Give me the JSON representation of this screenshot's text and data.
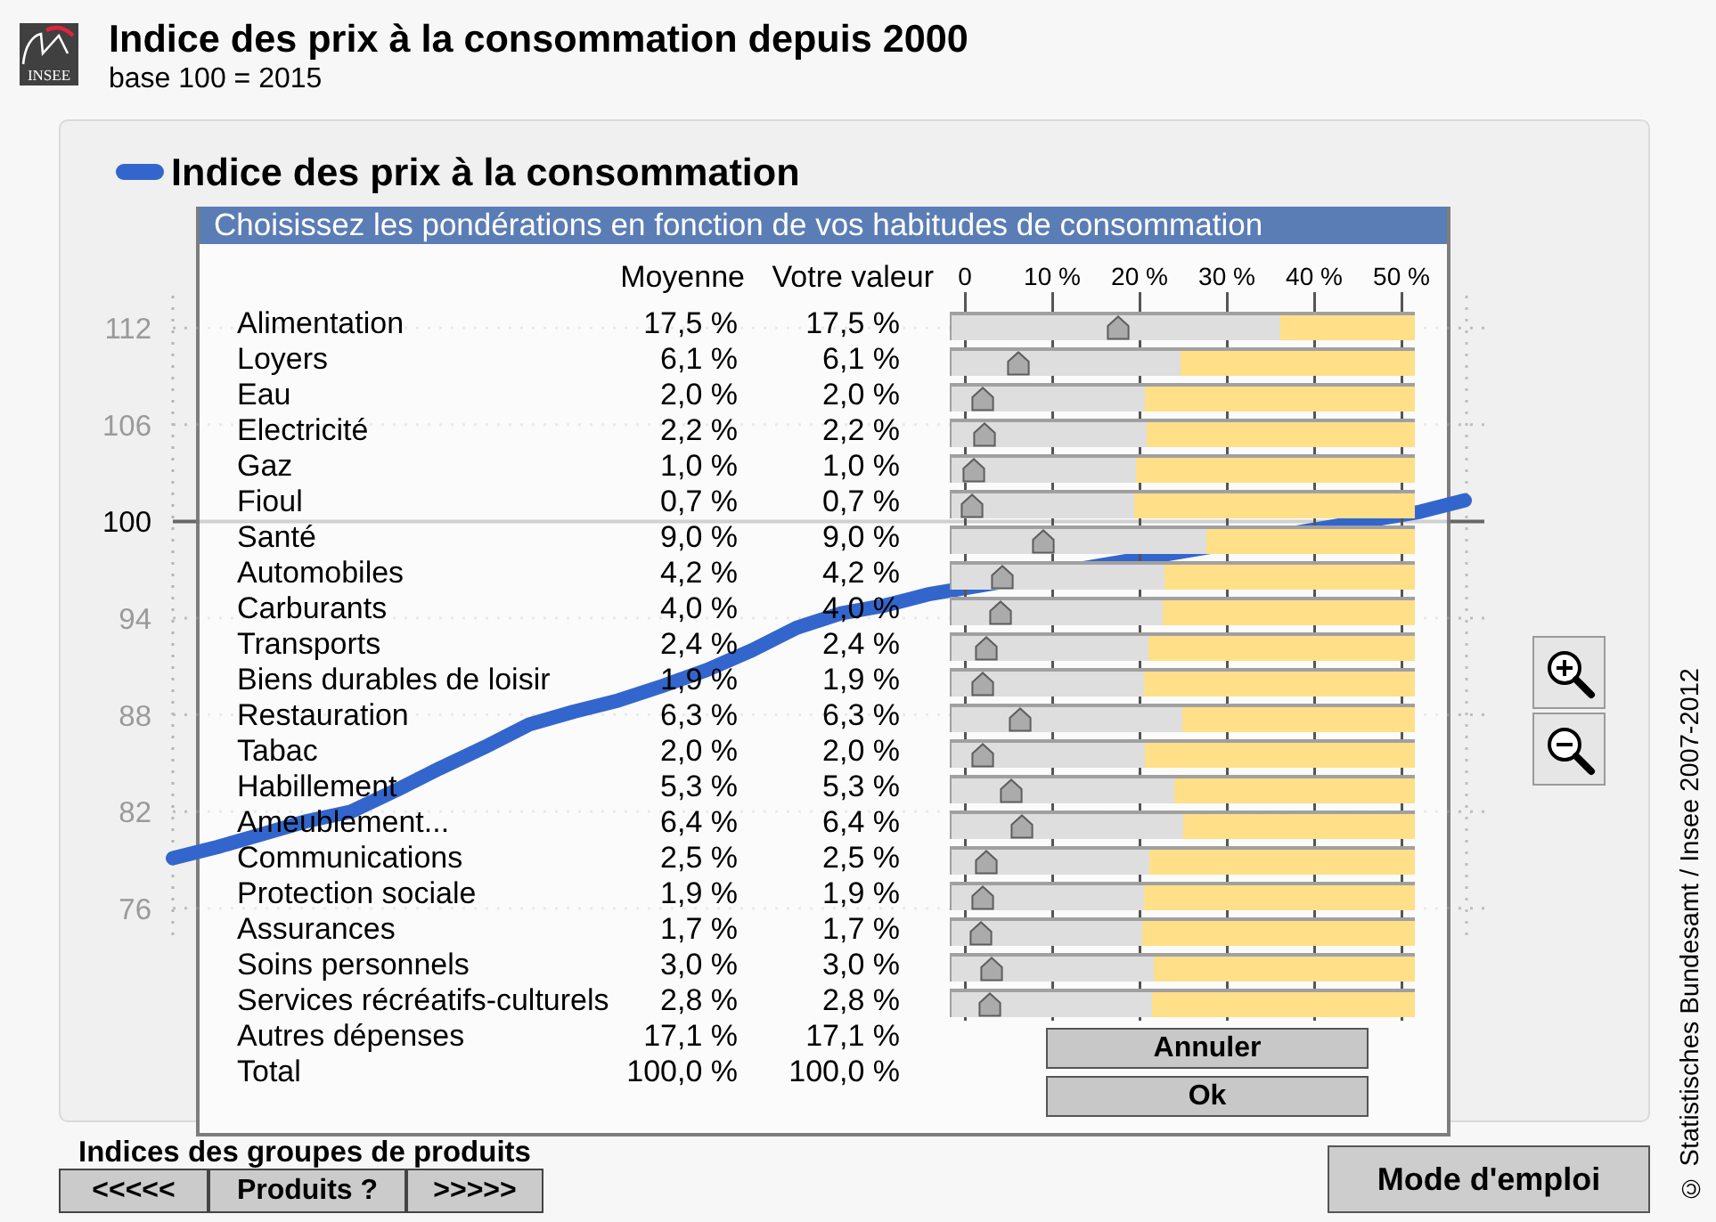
{
  "header": {
    "logo_text": "INSEE",
    "title": "Indice des prix à la consommation depuis 2000",
    "subtitle": "base 100 = 2015"
  },
  "chart": {
    "chart_data": {
      "type": "line",
      "ylim": [
        74,
        114
      ],
      "yticks": [
        76,
        82,
        88,
        94,
        100,
        106,
        112
      ],
      "grid": true,
      "ref_lines": [
        {
          "axis": "y",
          "value": 100
        }
      ],
      "series": [
        {
          "name": "Indice des prix à la consommation",
          "color": "#3366cc",
          "values": [
            79.1,
            79.8,
            80.6,
            81.4,
            82.0,
            83.3,
            84.7,
            86.0,
            87.4,
            88.2,
            88.9,
            89.8,
            90.8,
            92.0,
            93.4,
            94.3,
            94.8,
            95.5,
            null,
            null,
            null,
            null,
            null,
            null,
            null,
            null,
            null,
            null,
            100.6,
            101.3
          ]
        }
      ]
    }
  },
  "dialog": {
    "title": "Choisissez les pondérations en fonction de vos habitudes de consommation",
    "columns": [
      "Moyenne",
      "Votre valeur"
    ],
    "scale": [
      "0",
      "10 %",
      "20 %",
      "30 %",
      "40 %",
      "50 %"
    ],
    "rows": [
      {
        "label": "Alimentation",
        "average": "17,5 %",
        "value": "17,5 %",
        "kind": "slider",
        "level": 0.35
      },
      {
        "label": "Loyers",
        "average": "6,1 %",
        "value": "6,1 %",
        "kind": "slider",
        "level": 0.122
      },
      {
        "label": "Eau",
        "average": "2,0 %",
        "value": "2,0 %",
        "kind": "slider",
        "level": 0.04
      },
      {
        "label": "Electricité",
        "average": "2,2 %",
        "value": "2,2 %",
        "kind": "slider",
        "level": 0.044
      },
      {
        "label": "Gaz",
        "average": "1,0 %",
        "value": "1,0 %",
        "kind": "slider",
        "level": 0.02
      },
      {
        "label": "Fioul",
        "average": "0,7 %",
        "value": "0,7 %",
        "kind": "slider",
        "level": 0.014
      },
      {
        "label": "Santé",
        "average": "9,0 %",
        "value": "9,0 %",
        "kind": "slider",
        "level": 0.18
      },
      {
        "label": "Automobiles",
        "average": "4,2 %",
        "value": "4,2 %",
        "kind": "slider",
        "level": 0.084
      },
      {
        "label": "Carburants",
        "average": "4,0 %",
        "value": "4,0 %",
        "kind": "slider",
        "level": 0.08
      },
      {
        "label": "Transports",
        "average": "2,4 %",
        "value": "2,4 %",
        "kind": "slider",
        "level": 0.048
      },
      {
        "label": "Biens durables de loisir",
        "average": "1,9 %",
        "value": "1,9 %",
        "kind": "slider",
        "level": 0.038
      },
      {
        "label": "Restauration",
        "average": "6,3 %",
        "value": "6,3 %",
        "kind": "slider",
        "level": 0.126
      },
      {
        "label": "Tabac",
        "average": "2,0 %",
        "value": "2,0 %",
        "kind": "slider",
        "level": 0.04
      },
      {
        "label": "Habillement",
        "average": "5,3 %",
        "value": "5,3 %",
        "kind": "slider",
        "level": 0.106
      },
      {
        "label": "Ameublement...",
        "average": "6,4 %",
        "value": "6,4 %",
        "kind": "slider",
        "level": 0.128
      },
      {
        "label": "Communications",
        "average": "2,5 %",
        "value": "2,5 %",
        "kind": "slider",
        "level": 0.05
      },
      {
        "label": "Protection sociale",
        "average": "1,9 %",
        "value": "1,9 %",
        "kind": "slider",
        "level": 0.038
      },
      {
        "label": "Assurances",
        "average": "1,7 %",
        "value": "1,7 %",
        "kind": "slider",
        "level": 0.034
      },
      {
        "label": "Soins personnels",
        "average": "3,0 %",
        "value": "3,0 %",
        "kind": "slider",
        "level": 0.06
      },
      {
        "label": "Services récréatifs-culturels",
        "average": "2,8 %",
        "value": "2,8 %",
        "kind": "slider",
        "level": 0.056
      },
      {
        "label": "Autres dépenses",
        "average": "17,1 %",
        "value": "17,1 %",
        "kind": "plain"
      },
      {
        "label": "Total",
        "average": "100,0 %",
        "value": "100,0 %",
        "kind": "plain"
      }
    ],
    "buttons": [
      "Annuler",
      "Ok"
    ]
  },
  "bottom": {
    "group_label": "Indices des groupes de produits",
    "nav_buttons": [
      "<<<<<",
      "Produits ?",
      ">>>>>"
    ],
    "help_button": "Mode d'emploi"
  },
  "copyright": "© Statistisches Bundesamt / Insee 2007-2012"
}
